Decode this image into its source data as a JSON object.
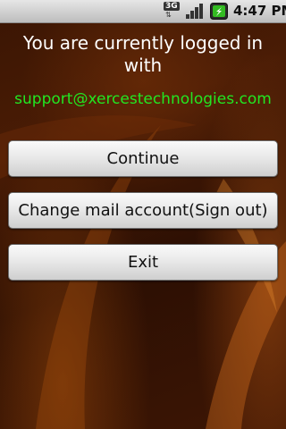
{
  "status_bar": {
    "network_label": "3G",
    "network_arrows": "⇅",
    "time": "4:47 PM",
    "signal_icon": "signal-icon",
    "battery_icon": "battery-charging-icon",
    "colors": {
      "bar": "#d2d2d2",
      "battery_fill": "#33bb22"
    }
  },
  "message": {
    "text": "You are currently logged in with",
    "email": "support@xercestechnologies.com",
    "email_color": "#22e622"
  },
  "buttons": {
    "continue": "Continue",
    "change_account": "Change mail account(Sign out)",
    "exit": "Exit"
  },
  "wallpaper": {
    "base_color": "#3a1503",
    "accent_color": "#b45a14"
  }
}
